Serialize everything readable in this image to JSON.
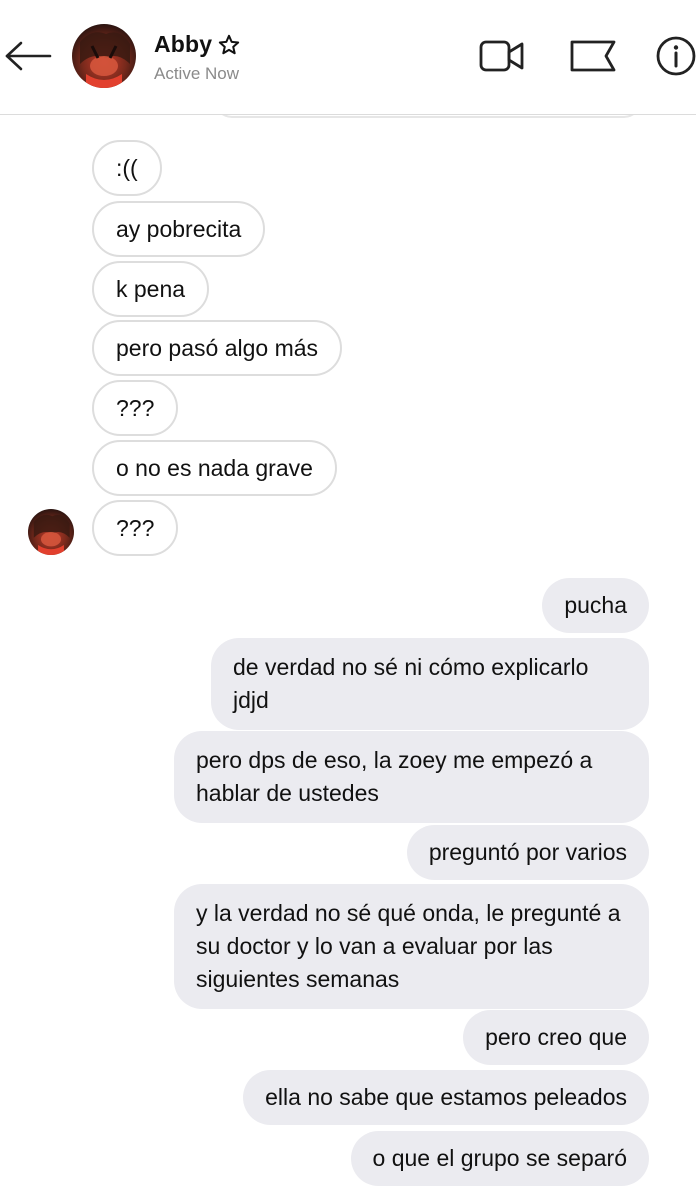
{
  "header": {
    "contact_name": "Abby",
    "status": "Active Now",
    "icons": {
      "back": "arrow-left-icon",
      "star": "star-outline-icon",
      "video": "video-camera-icon",
      "flag": "flag-icon",
      "info": "info-icon"
    }
  },
  "messages": {
    "received": [
      ":((",
      "ay pobrecita",
      "k pena",
      "pero pasó algo más",
      "???",
      "o no es nada grave",
      "???"
    ],
    "sent": [
      "pucha",
      "de verdad no sé ni cómo explicarlo jdjd",
      "pero dps de eso, la zoey me empezó a hablar de ustedes",
      "preguntó por varios",
      "y la verdad no sé qué onda, le pregunté a su doctor y lo van a evaluar por las siguientes semanas",
      "pero creo que",
      "ella no sabe que estamos peleados",
      "o que el grupo se separó"
    ]
  },
  "colors": {
    "sent_bubble": "#ebebf0",
    "received_border": "#dddddd",
    "status_text": "#8a8a8a"
  }
}
